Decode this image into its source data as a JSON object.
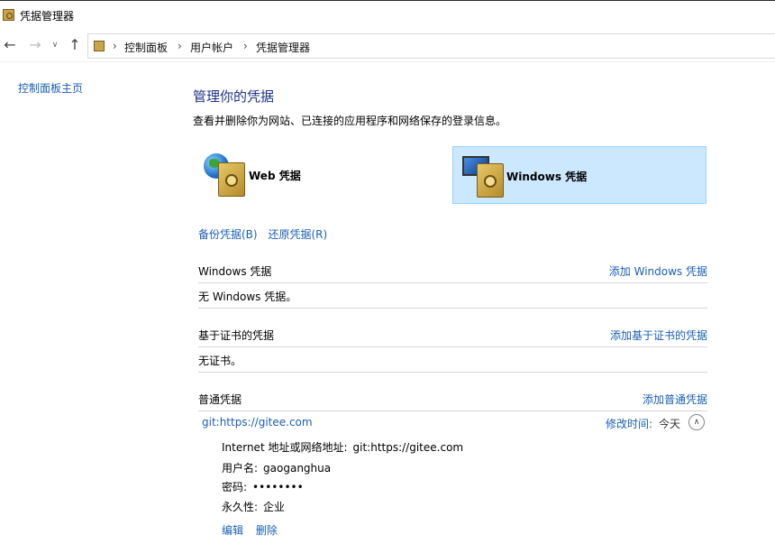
{
  "window": {
    "title": "凭据管理器"
  },
  "nav": {
    "back_icon": "arrow-left-icon",
    "forward_icon": "arrow-right-icon",
    "recent_icon": "chevron-down-icon",
    "up_icon": "arrow-up-icon",
    "breadcrumb": [
      "控制面板",
      "用户帐户",
      "凭据管理器"
    ]
  },
  "sidebar": {
    "home_link": "控制面板主页"
  },
  "main": {
    "heading": "管理你的凭据",
    "description": "查看并删除你为网站、已连接的应用程序和网络保存的登录信息。",
    "tiles": [
      {
        "label": "Web 凭据",
        "icon": "web-credentials-icon",
        "selected": false
      },
      {
        "label": "Windows 凭据",
        "icon": "windows-credentials-icon",
        "selected": true
      }
    ],
    "backup_link": "备份凭据(B)",
    "restore_link": "还原凭据(R)",
    "sections": {
      "windows": {
        "title": "Windows 凭据",
        "add": "添加 Windows 凭据",
        "empty": "无 Windows 凭据。"
      },
      "certificate": {
        "title": "基于证书的凭据",
        "add": "添加基于证书的凭据",
        "empty": "无证书。"
      },
      "generic": {
        "title": "普通凭据",
        "add": "添加普通凭据"
      }
    },
    "credential": {
      "name": "git:https://gitee.com",
      "modified_label": "修改时间:",
      "modified_value": "今天",
      "collapse_icon": "chevron-up-icon",
      "address_label": "Internet 地址或网络地址:",
      "address_value": "git:https://gitee.com",
      "user_label": "用户名:",
      "user_value": "gaoganghua",
      "password_label": "密码:",
      "password_value": "••••••••",
      "persistence_label": "永久性:",
      "persistence_value": "企业",
      "edit_link": "编辑",
      "delete_link": "删除"
    }
  },
  "colors": {
    "link": "#1a5fb4",
    "heading": "#1e3287",
    "selected_tile": "#cce8ff"
  }
}
